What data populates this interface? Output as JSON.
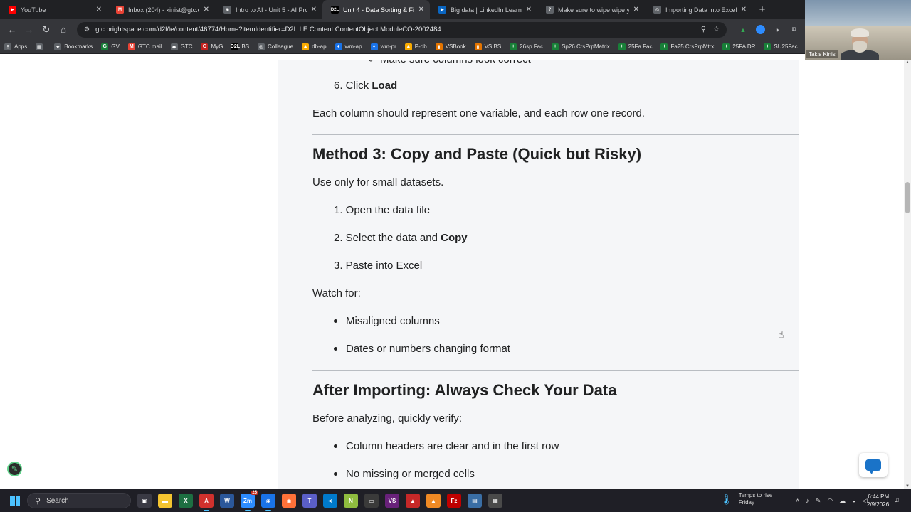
{
  "tabs": [
    {
      "title": "YouTube",
      "color": "#ff0000",
      "glyph": "▶",
      "active": false
    },
    {
      "title": "Inbox (204) - kinist@gtc.edu",
      "color": "#ea4335",
      "glyph": "M",
      "active": false
    },
    {
      "title": "Intro to AI - Unit 5 - AI Proje",
      "color": "#5f6368",
      "glyph": "◉",
      "active": false
    },
    {
      "title": "Unit 4 - Data Sorting & Filter",
      "color": "#000000",
      "glyph": "D2L",
      "active": true
    },
    {
      "title": "Big data | LinkedIn Learning",
      "color": "#0a66c2",
      "glyph": "▶",
      "active": false
    },
    {
      "title": "Make sure to wipe wipe your",
      "color": "#5f6368",
      "glyph": "?",
      "active": false
    },
    {
      "title": "Importing Data into Excel",
      "color": "#5f6368",
      "glyph": "◎",
      "active": false
    }
  ],
  "tab_close": "✕",
  "new_tab": "+",
  "toolbar": {
    "back": "←",
    "forward": "→",
    "reload": "↻",
    "home": "⌂",
    "url": "gtc.brightspace.com/d2l/le/content/46774/Home?itemIdentifier=D2L.LE.Content.ContentObject.ModuleCO-2002484",
    "zoom_icon": "⚲",
    "star_icon": "☆"
  },
  "bookmarks": [
    {
      "label": "Apps",
      "color": "#5f6368",
      "glyph": "⋮"
    },
    {
      "label": "",
      "color": "#5f6368",
      "glyph": "▦"
    },
    {
      "label": "Bookmarks",
      "color": "#5f6368",
      "glyph": "★"
    },
    {
      "label": "GV",
      "color": "#188038",
      "glyph": "G"
    },
    {
      "label": "GTC mail",
      "color": "#ea4335",
      "glyph": "M"
    },
    {
      "label": "GTC",
      "color": "#5f6368",
      "glyph": "◆"
    },
    {
      "label": "MyG",
      "color": "#c5221f",
      "glyph": "G"
    },
    {
      "label": "BS",
      "color": "#000000",
      "glyph": "D2L"
    },
    {
      "label": "Colleague",
      "color": "#5f6368",
      "glyph": "◎"
    },
    {
      "label": "db-ap",
      "color": "#f9ab00",
      "glyph": "▲"
    },
    {
      "label": "wm-ap",
      "color": "#1a73e8",
      "glyph": "♦"
    },
    {
      "label": "wm-pr",
      "color": "#1a73e8",
      "glyph": "♦"
    },
    {
      "label": "P-db",
      "color": "#f9ab00",
      "glyph": "▲"
    },
    {
      "label": "VSBook",
      "color": "#e37400",
      "glyph": "▮"
    },
    {
      "label": "VS BS",
      "color": "#e37400",
      "glyph": "▮"
    },
    {
      "label": "26sp Fac",
      "color": "#188038",
      "glyph": "+"
    },
    {
      "label": "Sp26 CrsPrpMatrix",
      "color": "#188038",
      "glyph": "+"
    },
    {
      "label": "25Fa Fac",
      "color": "#188038",
      "glyph": "+"
    },
    {
      "label": "Fa25 CrsPrpMtrx",
      "color": "#188038",
      "glyph": "+"
    },
    {
      "label": "25FA DR",
      "color": "#188038",
      "glyph": "+"
    },
    {
      "label": "SU25Fac",
      "color": "#188038",
      "glyph": "+"
    }
  ],
  "webcam": {
    "name": "Takis Kinis"
  },
  "content": {
    "top_subitem": "Make sure columns look correct",
    "step6_num": "6. Click ",
    "step6_bold": "Load",
    "para_column": "Each column should represent one variable, and each row one record.",
    "h_method3": "Method 3: Copy and Paste (Quick but Risky)",
    "para_small": "Use only for small datasets.",
    "m3_step1": "1. Open the data file",
    "m3_step2_pre": "2. Select the data and ",
    "m3_step2_bold": "Copy",
    "m3_step3": "3. Paste into Excel",
    "watch_for": "Watch for:",
    "watch_items": [
      "Misaligned columns",
      "Dates or numbers changing format"
    ],
    "h_after": "After Importing: Always Check Your Data",
    "before_analyzing": "Before analyzing, quickly verify:",
    "verify_items": [
      "Column headers are clear and in the first row",
      "No missing or merged cells"
    ]
  },
  "taskbar": {
    "search_label": "Search",
    "apps": [
      {
        "name": "task-view",
        "color": "#3a3a44",
        "glyph": "▣"
      },
      {
        "name": "file-explorer",
        "color": "#f4c430",
        "glyph": "▬"
      },
      {
        "name": "excel",
        "color": "#1d6f42",
        "glyph": "X"
      },
      {
        "name": "acrobat",
        "color": "#d0312d",
        "glyph": "A"
      },
      {
        "name": "word",
        "color": "#2b579a",
        "glyph": "W"
      },
      {
        "name": "zoom",
        "color": "#2d8cff",
        "glyph": "Zm"
      },
      {
        "name": "chrome",
        "color": "#1a73e8",
        "glyph": "◉"
      },
      {
        "name": "firefox",
        "color": "#ff7139",
        "glyph": "◉"
      },
      {
        "name": "teams",
        "color": "#5b5fc7",
        "glyph": "T"
      },
      {
        "name": "vscode",
        "color": "#007acc",
        "glyph": "≺"
      },
      {
        "name": "notepad-plus",
        "color": "#8fbc3f",
        "glyph": "N"
      },
      {
        "name": "terminal",
        "color": "#3a3a3a",
        "glyph": "▭"
      },
      {
        "name": "visual-studio",
        "color": "#68217a",
        "glyph": "VS"
      },
      {
        "name": "pdf-reader",
        "color": "#c62828",
        "glyph": "▲"
      },
      {
        "name": "vlc",
        "color": "#f08a24",
        "glyph": "▲"
      },
      {
        "name": "filezilla",
        "color": "#bf0000",
        "glyph": "Fz"
      },
      {
        "name": "snip",
        "color": "#3a6ea5",
        "glyph": "▤"
      },
      {
        "name": "calculator",
        "color": "#4a4a4a",
        "glyph": "▦"
      }
    ],
    "zoom_badge": "25",
    "weather_line1": "Temps to rise",
    "weather_line2": "Friday",
    "time": "6:44 PM",
    "date": "2/9/2026"
  }
}
